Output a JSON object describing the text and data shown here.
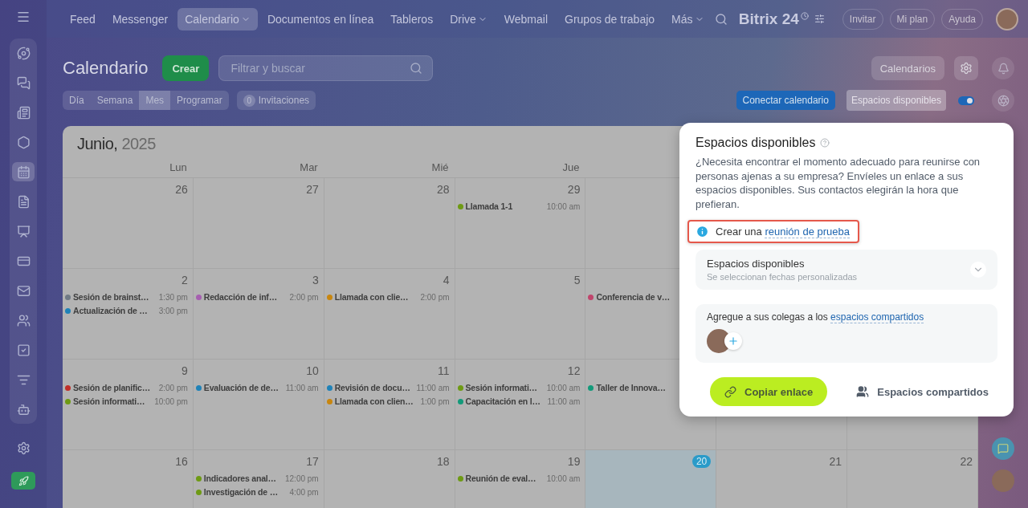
{
  "nav": {
    "items": [
      {
        "label": "Feed",
        "selected": false,
        "dropdown": false
      },
      {
        "label": "Messenger",
        "selected": false,
        "dropdown": false
      },
      {
        "label": "Calendario",
        "selected": true,
        "dropdown": true
      },
      {
        "label": "Documentos en línea",
        "selected": false,
        "dropdown": false
      },
      {
        "label": "Tableros",
        "selected": false,
        "dropdown": false
      },
      {
        "label": "Drive",
        "selected": false,
        "dropdown": true
      },
      {
        "label": "Webmail",
        "selected": false,
        "dropdown": false
      },
      {
        "label": "Grupos de trabajo",
        "selected": false,
        "dropdown": false
      },
      {
        "label": "Más",
        "selected": false,
        "dropdown": true
      }
    ],
    "logo": "Bitrix 24",
    "buttons": [
      "Invitar",
      "Mi plan",
      "Ayuda"
    ]
  },
  "sidebar": {
    "items": [
      {
        "selected": false
      },
      {
        "selected": false
      },
      {
        "selected": false
      },
      {
        "selected": false
      },
      {
        "selected": true
      },
      {
        "selected": false
      },
      {
        "selected": false
      },
      {
        "selected": false
      },
      {
        "selected": false
      },
      {
        "selected": false
      },
      {
        "selected": false
      },
      {
        "selected": false
      },
      {
        "selected": false
      }
    ]
  },
  "page": {
    "title": "Calendario",
    "create_button": "Crear",
    "search": {
      "placeholder": "Filtrar y buscar"
    },
    "calendars_button": "Calendarios"
  },
  "view_tabs": [
    {
      "label": "Día",
      "selected": false
    },
    {
      "label": "Semana",
      "selected": false
    },
    {
      "label": "Mes",
      "selected": true
    },
    {
      "label": "Programar",
      "selected": false
    }
  ],
  "invitations": {
    "count": "0",
    "label": "Invitaciones"
  },
  "connect_button": "Conectar calendario",
  "slots_button": {
    "label": "Espacios disponibles",
    "selected": true
  },
  "slots_toggle": {
    "on": true
  },
  "calendar": {
    "month": "Junio,",
    "year": "2025",
    "day_names": [
      "Lun",
      "Mar",
      "Mié",
      "Jue"
    ],
    "weeks": [
      {
        "days": [
          {
            "date": "26",
            "today": false
          },
          {
            "date": "27",
            "today": false
          },
          {
            "date": "28",
            "today": false
          },
          {
            "date": "29",
            "today": false,
            "events": [
              {
                "title": "Llamada 1-1",
                "time": "10:00 am",
                "color": "#6e9a14"
              }
            ]
          }
        ]
      },
      {
        "days": [
          {
            "date": "2",
            "today": false,
            "events": [
              {
                "title": "Sesión de brainst…",
                "time": "1:30 pm",
                "color": "#707a85"
              },
              {
                "title": "Actualización de …",
                "time": "3:00 pm",
                "color": "#1f82b8"
              }
            ]
          },
          {
            "date": "3",
            "today": false,
            "events": [
              {
                "title": "Redacción de inf…",
                "time": "2:00 pm",
                "color": "#a65fb0"
              }
            ]
          },
          {
            "date": "4",
            "today": false,
            "events": [
              {
                "title": "Llamada con clie…",
                "time": "2:00 pm",
                "color": "#c8860f"
              }
            ]
          },
          {
            "date": "5",
            "today": false
          },
          {
            "events": [
              {
                "title": "Conferencia de v…",
                "color": "#c0456c"
              }
            ]
          }
        ]
      },
      {
        "days": [
          {
            "date": "9",
            "today": false,
            "events": [
              {
                "title": "Sesión de planific…",
                "time": "2:00 pm",
                "color": "#c0302a"
              },
              {
                "title": "Sesión informati…",
                "time": "10:00 pm",
                "color": "#6e9a14"
              }
            ]
          },
          {
            "date": "10",
            "today": false,
            "events": [
              {
                "title": "Evaluación de de…",
                "time": "11:00 am",
                "color": "#1f82b8"
              }
            ]
          },
          {
            "date": "11",
            "today": false,
            "events": [
              {
                "title": "Revisión de docu…",
                "time": "11:00 am",
                "color": "#1f82b8"
              },
              {
                "title": "Llamada con clien…",
                "time": "1:00 pm",
                "color": "#c8860f"
              }
            ]
          },
          {
            "date": "12",
            "today": false,
            "events": [
              {
                "title": "Sesión informati…",
                "time": "10:00 am",
                "color": "#6e9a14"
              },
              {
                "title": "Capacitación en l…",
                "time": "11:00 am",
                "color": "#139a7a"
              }
            ]
          },
          {
            "events": [
              {
                "title": "Taller de Innova…",
                "color": "#139a7a"
              }
            ]
          }
        ]
      },
      {
        "days": [
          {
            "date": "16",
            "today": false
          },
          {
            "date": "17",
            "today": false,
            "events": [
              {
                "title": "Indicadores anal…",
                "time": "12:00 pm",
                "color": "#6e9a14"
              },
              {
                "title": "Investigación de …",
                "time": "4:00 pm",
                "color": "#6e9a14"
              }
            ]
          },
          {
            "date": "18",
            "today": false
          },
          {
            "date": "19",
            "today": false,
            "events": [
              {
                "title": "Reunión de eval…",
                "time": "10:00 am",
                "color": "#6e9a14"
              }
            ]
          },
          {
            "date": "20",
            "today": true
          },
          {
            "date": "21",
            "today": false
          },
          {
            "date": "22",
            "today": false
          }
        ]
      }
    ]
  },
  "popup": {
    "title": "Espacios disponibles",
    "description": "¿Necesita encontrar el momento adecuado para reunirse con personas ajenas a su empresa? Envíeles un enlace a sus espacios disponibles. Sus contactos elegirán la hora que prefieran.",
    "test_meeting": {
      "prefix": "Crear una",
      "link": "reunión de prueba"
    },
    "slots_section": {
      "title": "Espacios disponibles",
      "subtitle": "Se seleccionan fechas personalizadas"
    },
    "colleagues": {
      "prefix": "Agregue a sus colegas a los",
      "link": "espacios compartidos"
    },
    "copy_button": "Copiar enlace",
    "shared_button": "Espacios compartidos"
  }
}
